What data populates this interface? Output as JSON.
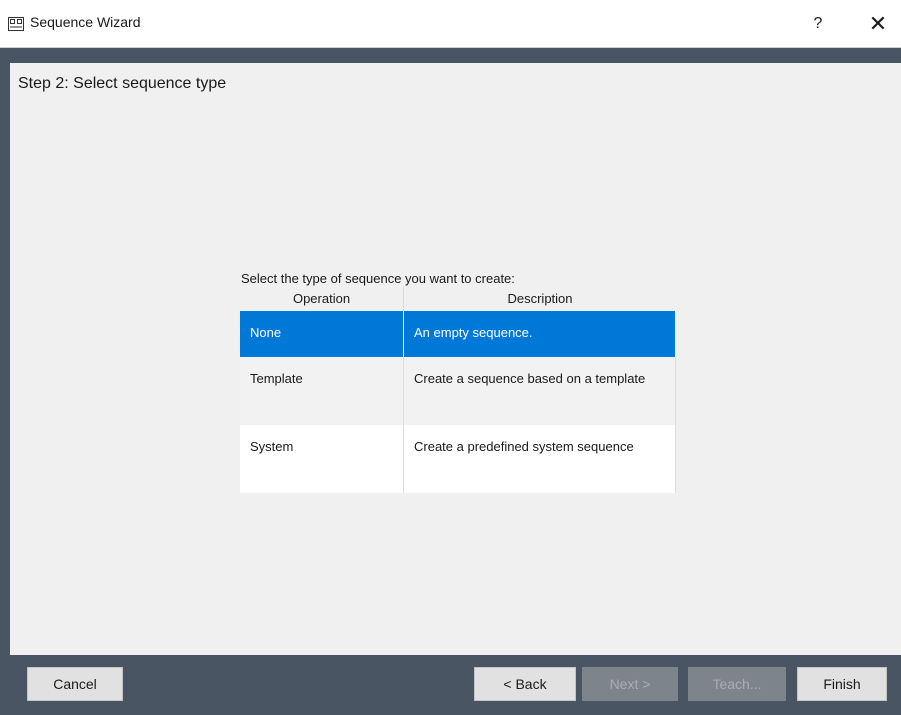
{
  "window": {
    "title": "Sequence Wizard",
    "help_label": "?",
    "close_label": "✕"
  },
  "step": {
    "title": "Step 2: Select sequence type"
  },
  "selector": {
    "prompt": "Select the type of sequence you want to create:",
    "columns": [
      "Operation",
      "Description"
    ],
    "rows": [
      {
        "operation": "None",
        "description": "An empty sequence.",
        "selected": true
      },
      {
        "operation": "Template",
        "description": "Create a sequence based on a template",
        "selected": false
      },
      {
        "operation": "System",
        "description": "Create a predefined system sequence",
        "selected": false
      }
    ]
  },
  "buttons": {
    "cancel": "Cancel",
    "back": "< Back",
    "next": "Next >",
    "teach": "Teach...",
    "finish": "Finish"
  },
  "colors": {
    "selection": "#0078d7",
    "footer": "#4a5563"
  }
}
